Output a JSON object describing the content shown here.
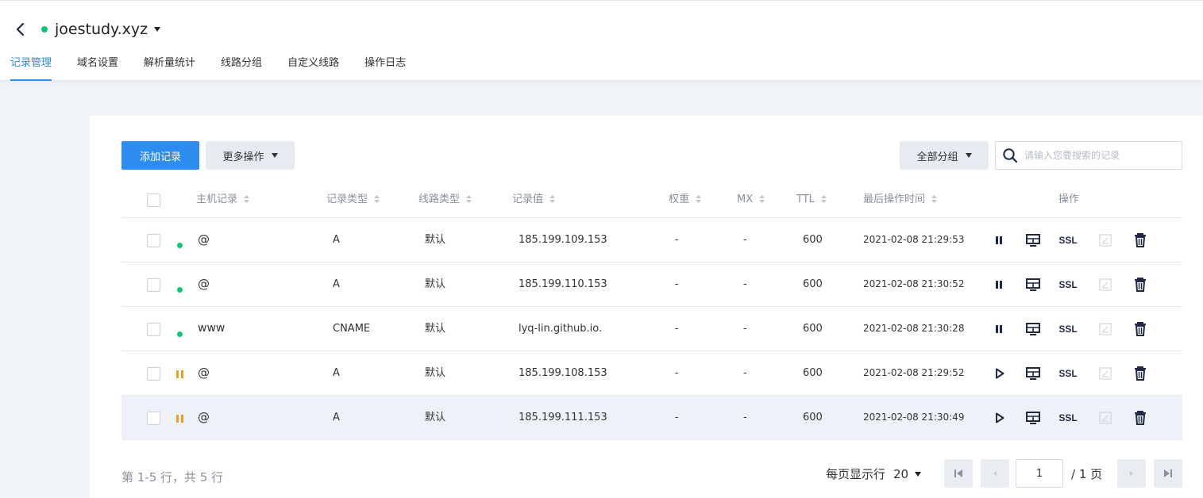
{
  "header": {
    "domain": "joestudy.xyz",
    "tabs": [
      "记录管理",
      "域名设置",
      "解析量统计",
      "线路分组",
      "自定义线路",
      "操作日志"
    ]
  },
  "toolbar": {
    "add_label": "添加记录",
    "more_label": "更多操作",
    "group_label": "全部分组",
    "search_placeholder": "请输入您要搜索的记录"
  },
  "columns": {
    "host": "主机记录",
    "type": "记录类型",
    "line": "线路类型",
    "value": "记录值",
    "weight": "权重",
    "mx": "MX",
    "ttl": "TTL",
    "time": "最后操作时间",
    "ops": "操作"
  },
  "rows": [
    {
      "status": "enabled",
      "host": "@",
      "type": "A",
      "line": "默认",
      "value": "185.199.109.153",
      "weight": "-",
      "mx": "-",
      "ttl": "600",
      "time": "2021-02-08 21:29:53",
      "ssl": "SSL"
    },
    {
      "status": "enabled",
      "host": "@",
      "type": "A",
      "line": "默认",
      "value": "185.199.110.153",
      "weight": "-",
      "mx": "-",
      "ttl": "600",
      "time": "2021-02-08 21:30:52",
      "ssl": "SSL"
    },
    {
      "status": "enabled",
      "host": "www",
      "type": "CNAME",
      "line": "默认",
      "value": "lyq-lin.github.io.",
      "weight": "-",
      "mx": "-",
      "ttl": "600",
      "time": "2021-02-08 21:30:28",
      "ssl": "SSL"
    },
    {
      "status": "paused",
      "host": "@",
      "type": "A",
      "line": "默认",
      "value": "185.199.108.153",
      "weight": "-",
      "mx": "-",
      "ttl": "600",
      "time": "2021-02-08 21:29:52",
      "ssl": "SSL"
    },
    {
      "status": "paused",
      "host": "@",
      "type": "A",
      "line": "默认",
      "value": "185.199.111.153",
      "weight": "-",
      "mx": "-",
      "ttl": "600",
      "time": "2021-02-08 21:30:49",
      "ssl": "SSL"
    }
  ],
  "footer": {
    "info": "第 1-5 行，共 5 行",
    "per_page_label": "每页显示行",
    "per_page_value": "20",
    "page_value": "1",
    "page_total": "/ 1 页"
  },
  "colors": {
    "accent": "#2d8cf0",
    "enabled": "#12c37b",
    "paused": "#f0a020"
  }
}
